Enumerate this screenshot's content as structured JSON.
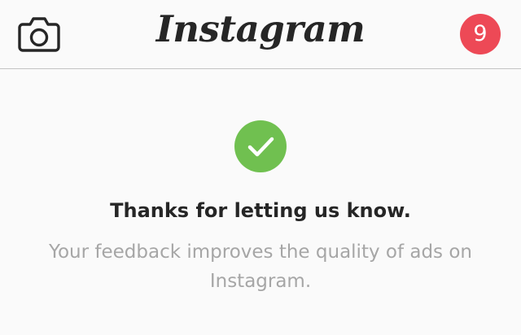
{
  "header": {
    "logo": "Instagram",
    "camera_icon": "camera-icon",
    "notification_count": "9",
    "badge_color": "#ed4956"
  },
  "feedback": {
    "icon": "checkmark-icon",
    "icon_color": "#70c050",
    "title": "Thanks for letting us know.",
    "message": "Your feedback improves the quality of ads on Instagram."
  }
}
